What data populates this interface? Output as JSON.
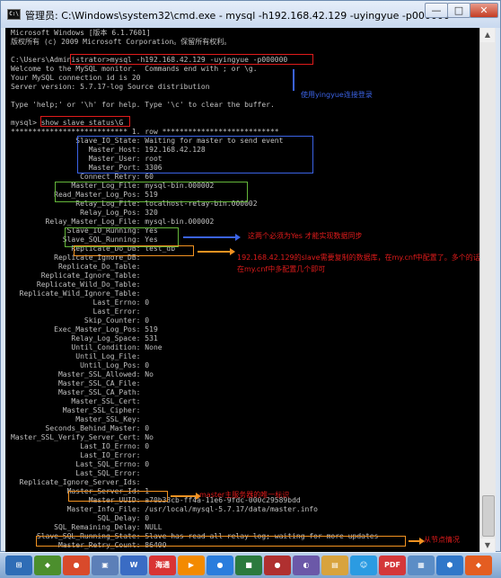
{
  "window": {
    "title": "管理员: C:\\Windows\\system32\\cmd.exe - mysql  -h192.168.42.129 -uyingyue -p000000",
    "buttons": [
      "—",
      "□",
      "✕"
    ],
    "icon": "console-icon"
  },
  "console": {
    "lines": [
      "Microsoft Windows [版本 6.1.7601]",
      "版权所有 (c) 2009 Microsoft Corporation。保留所有权利。",
      "",
      "C:\\Users\\Administrator>mysql -h192.168.42.129 -uyingyue -p000000",
      "Welcome to the MySQL monitor.  Commands end with ; or \\g.",
      "Your MySQL connection id is 20",
      "Server version: 5.7.17-log Source distribution",
      "",
      "Type 'help;' or '\\h' for help. Type '\\c' to clear the buffer.",
      "",
      "mysql> show slave status\\G",
      "*************************** 1. row ***************************",
      "               Slave_IO_State: Waiting for master to send event",
      "                  Master_Host: 192.168.42.128",
      "                  Master_User: root",
      "                  Master_Port: 3306",
      "                Connect_Retry: 60",
      "              Master_Log_File: mysql-bin.000002",
      "          Read_Master_Log_Pos: 519",
      "               Relay_Log_File: localhost-relay-bin.000002",
      "                Relay_Log_Pos: 320",
      "        Relay_Master_Log_File: mysql-bin.000002",
      "             Slave_IO_Running: Yes",
      "            Slave_SQL_Running: Yes",
      "              Replicate_Do_DB: test_db",
      "          Replicate_Ignore_DB:",
      "           Replicate_Do_Table:",
      "       Replicate_Ignore_Table:",
      "      Replicate_Wild_Do_Table:",
      "  Replicate_Wild_Ignore_Table:",
      "                   Last_Errno: 0",
      "                   Last_Error:",
      "                 Skip_Counter: 0",
      "          Exec_Master_Log_Pos: 519",
      "              Relay_Log_Space: 531",
      "              Until_Condition: None",
      "               Until_Log_File:",
      "                Until_Log_Pos: 0",
      "           Master_SSL_Allowed: No",
      "           Master_SSL_CA_File:",
      "           Master_SSL_CA_Path:",
      "              Master_SSL_Cert:",
      "            Master_SSL_Cipher:",
      "               Master_SSL_Key:",
      "        Seconds_Behind_Master: 0",
      "Master_SSL_Verify_Server_Cert: No",
      "                Last_IO_Errno: 0",
      "                Last_IO_Error:",
      "               Last_SQL_Errno: 0",
      "               Last_SQL_Error:",
      "  Replicate_Ignore_Server_Ids:",
      "             Master_Server_Id: 1",
      "                  Master_UUID: a70b33cb-ff4a-11e6-9fdc-000c29589bdd",
      "             Master_Info_File: /usr/local/mysql-5.7.17/data/master.info",
      "                    SQL_Delay: 0",
      "          SQL_Remaining_Delay: NULL",
      "      Slave_SQL_Running_State: Slave has read all relay log; waiting for more updates",
      "           Master_Retry_Count: 86400"
    ]
  },
  "annotations": [
    {
      "text": "使用yingyue连接登录",
      "color": "#3b63e6"
    },
    {
      "text": "这两个必须为Yes 才能实现数据同步",
      "color": "#e01b1b"
    },
    {
      "text": "192.168.42.129的slave需要复制的数据库，在my.cnf中配置了。多个的话",
      "color": "#e01b1b"
    },
    {
      "text": "在my.cnf中多配置几个即可",
      "color": "#e01b1b"
    },
    {
      "text": "master主服务器的唯一标识",
      "color": "#e01b1b"
    },
    {
      "text": "从节点情况",
      "color": "#e01b1b"
    }
  ],
  "taskbar": {
    "items": [
      {
        "label": "⊞",
        "color": "#2f6db6",
        "icon": "start-icon"
      },
      {
        "label": "◆",
        "color": "#4c8f2d",
        "icon": "shield-icon"
      },
      {
        "label": "●",
        "color": "#d94a2b",
        "icon": "browser-icon"
      },
      {
        "label": "▣",
        "color": "#5c7fb8",
        "icon": "files-icon"
      },
      {
        "label": "W",
        "color": "#3a6cc4",
        "icon": "word-icon"
      },
      {
        "label": "海通",
        "color": "#d93434",
        "icon": "app-icon"
      },
      {
        "label": "▶",
        "color": "#f38a00",
        "icon": "firefox-icon"
      },
      {
        "label": "●",
        "color": "#2a7ddd",
        "icon": "chrome-icon"
      },
      {
        "label": "■",
        "color": "#2b7a3e",
        "icon": "terminal-icon"
      },
      {
        "label": "●",
        "color": "#b03030",
        "icon": "media-icon"
      },
      {
        "label": "◐",
        "color": "#6b58a8",
        "icon": "mail-icon"
      },
      {
        "label": "▤",
        "color": "#d8a33d",
        "icon": "folder-icon"
      },
      {
        "label": "☺",
        "color": "#2b9be2",
        "icon": "chat-icon"
      },
      {
        "label": "PDF",
        "color": "#d4373a",
        "icon": "pdf-icon"
      },
      {
        "label": "▦",
        "color": "#5b8dc6",
        "icon": "tools-icon"
      },
      {
        "label": "⬢",
        "color": "#3077c9",
        "icon": "settings-icon"
      },
      {
        "label": "◆",
        "color": "#e45d21",
        "icon": "ui-icon"
      }
    ]
  }
}
